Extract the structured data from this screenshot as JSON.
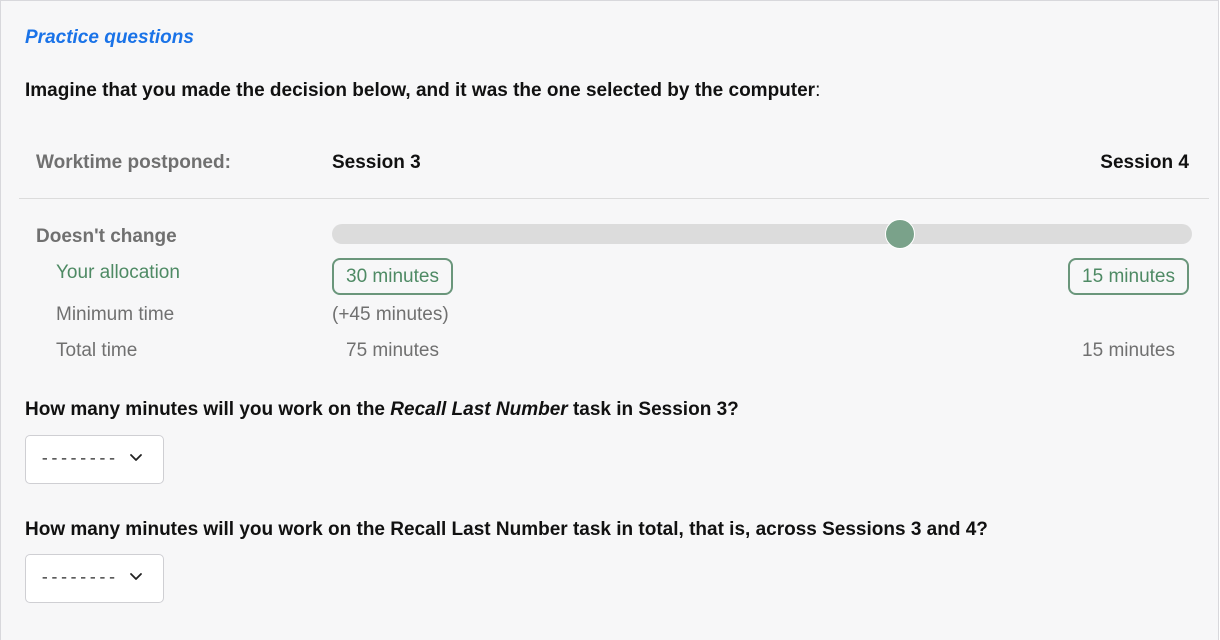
{
  "title": "Practice questions",
  "intro": {
    "text": "Imagine that you made the decision below, and it was the one selected by the computer",
    "colon": ":"
  },
  "header": {
    "label": "Worktime postponed:",
    "session_a": "Session 3",
    "session_b": "Session 4"
  },
  "scenario": {
    "label": "Doesn't change",
    "slider_value_fraction": 0.66,
    "rows": {
      "allocation_label": "Your allocation",
      "minimum_label": "Minimum time",
      "total_label": "Total time"
    },
    "session_a": {
      "allocation": "30 minutes",
      "minimum": "(+45 minutes)",
      "total": "75 minutes"
    },
    "session_b": {
      "allocation": "15 minutes",
      "total": "15 minutes"
    }
  },
  "questions": [
    {
      "prefix": "How many minutes will you work on the ",
      "emphasis": "Recall Last Number",
      "suffix": " task in Session 3?",
      "select_value": "--------"
    },
    {
      "text": "How many minutes will you work on the Recall Last Number task in total, that is, across Sessions 3 and 4?",
      "select_value": "--------"
    }
  ],
  "colors": {
    "accent_blue": "#1a73e8",
    "green": "#4e8a64",
    "slider_thumb": "#7aa28a"
  },
  "icons": {
    "select_chevron": "chevron-down-icon"
  }
}
